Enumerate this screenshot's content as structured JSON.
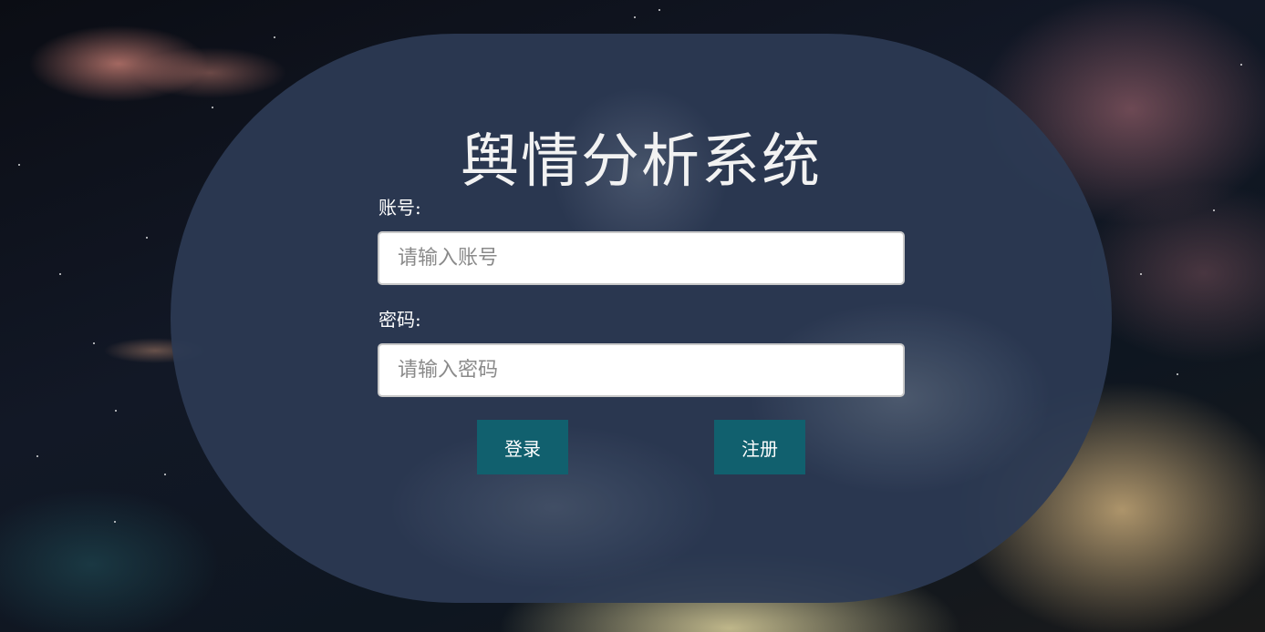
{
  "title": "舆情分析系统",
  "form": {
    "account_label": "账号:",
    "account_placeholder": "请输入账号",
    "account_value": "",
    "password_label": "密码:",
    "password_placeholder": "请输入密码",
    "password_value": ""
  },
  "buttons": {
    "login": "登录",
    "register": "注册"
  },
  "colors": {
    "panel": "#2c3a54",
    "button": "#11606e",
    "title_text": "#f2f2f2"
  }
}
